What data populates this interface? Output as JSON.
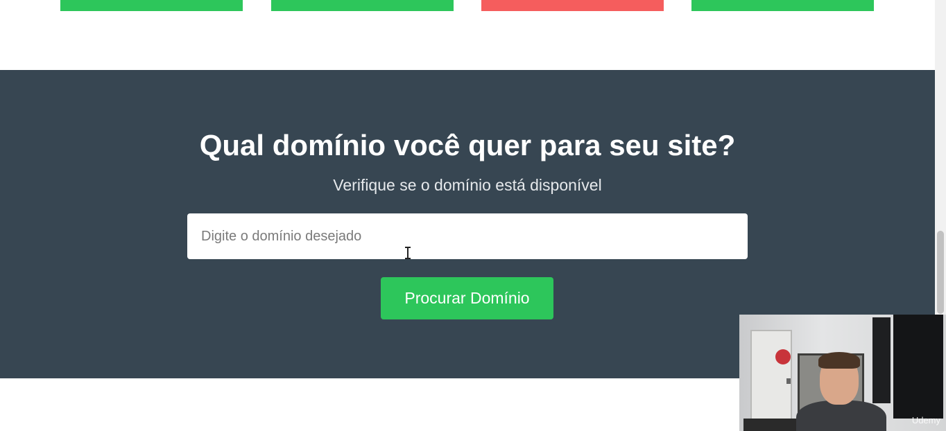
{
  "domain_search": {
    "title": "Qual domínio você quer para seu site?",
    "subtitle": "Verifique se o domínio está disponível",
    "input_placeholder": "Digite o domínio desejado",
    "button_label": "Procurar Domínio"
  },
  "plan_buttons": [
    {
      "color": "#2dc65b"
    },
    {
      "color": "#2dc65b"
    },
    {
      "color": "#f55d5d"
    },
    {
      "color": "#2dc65b"
    }
  ],
  "webcam": {
    "watermark": "Udemy"
  },
  "colors": {
    "section_bg": "#374652",
    "accent_green": "#2dc65b",
    "accent_red": "#f55d5d"
  }
}
